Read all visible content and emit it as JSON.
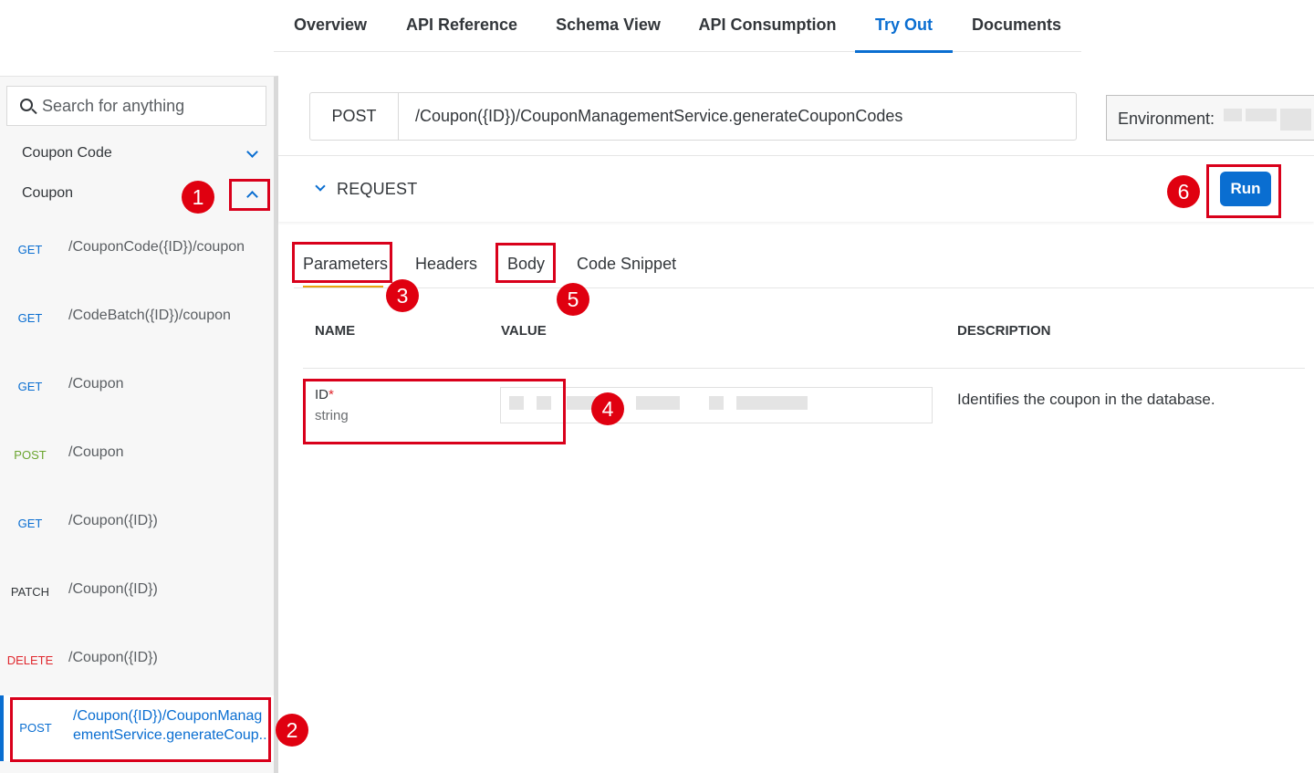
{
  "top_tabs": [
    {
      "label": "Overview"
    },
    {
      "label": "API Reference"
    },
    {
      "label": "Schema View"
    },
    {
      "label": "API Consumption"
    },
    {
      "label": "Try Out",
      "active": true
    },
    {
      "label": "Documents"
    }
  ],
  "sidebar": {
    "search_placeholder": "Search for anything",
    "groups": [
      {
        "label": "Coupon Code",
        "state": "collapsed"
      },
      {
        "label": "Coupon",
        "state": "expanded"
      }
    ],
    "endpoints": [
      {
        "method": "GET",
        "path": "/CouponCode({ID})/coupon"
      },
      {
        "method": "GET",
        "path": "/CodeBatch({ID})/coupon"
      },
      {
        "method": "GET",
        "path": "/Coupon"
      },
      {
        "method": "POST",
        "path": "/Coupon"
      },
      {
        "method": "GET",
        "path": "/Coupon({ID})"
      },
      {
        "method": "PATCH",
        "path": "/Coupon({ID})"
      },
      {
        "method": "DELETE",
        "path": "/Coupon({ID})"
      },
      {
        "method": "POST",
        "path_line1": "/Coupon({ID})/CouponManag",
        "path_line2": "ementService.generateCoup...",
        "selected": true
      }
    ]
  },
  "request": {
    "method": "POST",
    "url": "/Coupon({ID})/CouponManagementService.generateCouponCodes",
    "environment_label": "Environment:",
    "section_label": "REQUEST",
    "run_label": "Run"
  },
  "subtabs": [
    {
      "label": "Parameters",
      "active": true
    },
    {
      "label": "Headers"
    },
    {
      "label": "Body"
    },
    {
      "label": "Code Snippet"
    }
  ],
  "params_table": {
    "headers": {
      "name": "NAME",
      "value": "VALUE",
      "description": "DESCRIPTION"
    },
    "rows": [
      {
        "name": "ID",
        "required_mark": "*",
        "type": "string",
        "description": "Identifies the coupon in the database."
      }
    ]
  },
  "annotations": [
    "1",
    "2",
    "3",
    "4",
    "5",
    "6"
  ],
  "colors": {
    "accent": "#0a6ed1",
    "get": "#0a6ed1",
    "post": "#6ba52f",
    "delete": "#e0282e",
    "annotation_red": "#d9001b",
    "active_subtab_underline": "#e9a30e"
  }
}
